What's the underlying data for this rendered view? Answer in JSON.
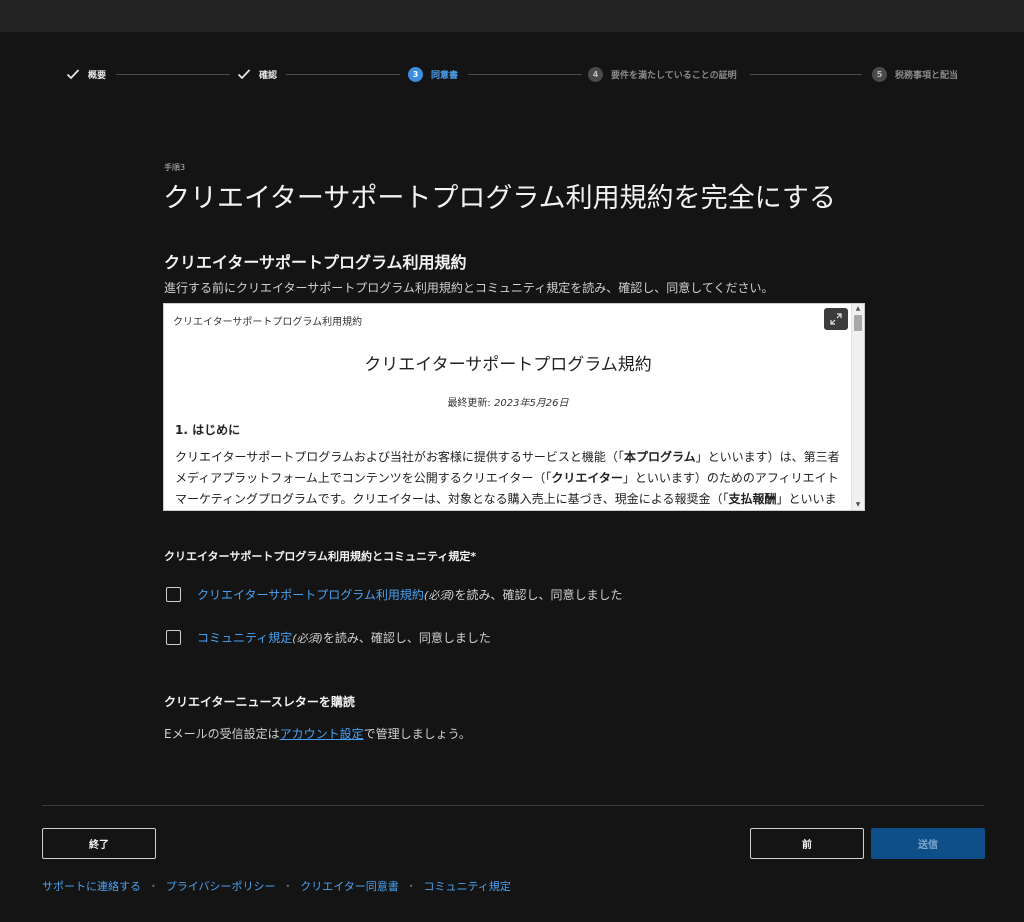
{
  "stepper": {
    "steps": [
      {
        "label": "概要",
        "state": "done"
      },
      {
        "label": "確認",
        "state": "done"
      },
      {
        "label": "同意書",
        "number": "3",
        "state": "active"
      },
      {
        "label": "要件を満たしていることの証明",
        "number": "4",
        "state": "pending"
      },
      {
        "label": "税務事項と配当",
        "number": "5",
        "state": "pending"
      }
    ]
  },
  "main": {
    "step_label": "手順3",
    "title": "クリエイターサポートプログラム利用規約を完全にする",
    "section_title": "クリエイターサポートプログラム利用規約",
    "section_desc": "進行する前にクリエイターサポートプログラム利用規約とコミュニティ規定を読み、確認し、同意してください。"
  },
  "terms_box": {
    "label": "クリエイターサポートプログラム利用規約",
    "doc_title": "クリエイターサポートプログラム規約",
    "updated_prefix": "最終更新:",
    "updated_date": "2023年5月26日",
    "heading": "1. はじめに",
    "para": {
      "p1": "クリエイターサポートプログラムおよび当社がお客様に提供するサービスと機能（「",
      "b1": "本プログラム",
      "p2": "」といいます）は、第三者メディアプラットフォーム上でコンテンツを公開するクリエイター（「",
      "b2": "クリエイター",
      "p3": "」といいます）のためのアフィリエイトマーケティングプログラムです。クリエイターは、対象となる購入売上に基づき、現金による報奨金（「",
      "b3": "支払報酬",
      "p4": "」といいます）を受け取ることができます。"
    }
  },
  "agreement": {
    "title": "クリエイターサポートプログラム利用規約とコミュニティ規定*",
    "items": [
      {
        "link": "クリエイターサポートプログラム利用規約",
        "required": "(必須)",
        "text": "を読み、確認し、同意しました",
        "checked": false
      },
      {
        "link": "コミュニティ規定",
        "required": "(必須)",
        "text": "を読み、確認し、同意しました",
        "checked": false
      }
    ]
  },
  "newsletter": {
    "title": "クリエイターニュースレターを購読",
    "desc_prefix": "Eメールの受信設定は",
    "desc_link": "アカウント設定",
    "desc_suffix": "で管理しましょう。"
  },
  "buttons": {
    "exit": "終了",
    "prev": "前",
    "submit": "送信"
  },
  "footer": {
    "links": [
      "サポートに連絡する",
      "プライバシーポリシー",
      "クリエイター同意書",
      "コミュニティ規定"
    ],
    "separator": "•"
  },
  "colors": {
    "background": "#141414",
    "accent": "#4aa0f0",
    "submit_bg": "#0e4f8a"
  },
  "icons": {
    "done": "check-icon",
    "expand": "expand-icon",
    "scroll_up": "triangle-up-icon",
    "scroll_down": "triangle-down-icon"
  }
}
